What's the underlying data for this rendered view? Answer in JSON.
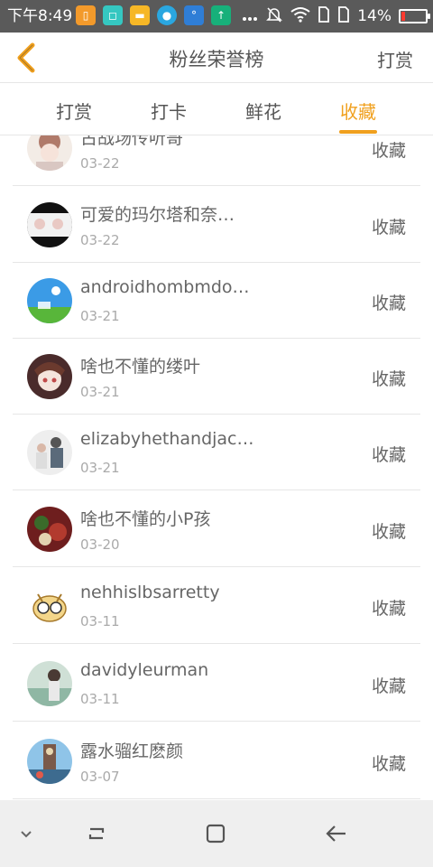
{
  "status_bar": {
    "time": "下午8:49",
    "battery_percent": "14%",
    "battery_level": 0.14,
    "app_icons": [
      {
        "name": "orange-app-icon",
        "color": "#f39a2b"
      },
      {
        "name": "scan-app-icon",
        "color": "#35c7c1"
      },
      {
        "name": "files-app-icon",
        "color": "#f6b726"
      },
      {
        "name": "palette-app-icon",
        "color": "#2aa7e0"
      },
      {
        "name": "weather-app-icon",
        "color": "#2f7ed6"
      },
      {
        "name": "upload-app-icon",
        "color": "#17b07a"
      }
    ],
    "right_icons": [
      "more-dots-icon",
      "mute-bell-icon",
      "wifi-icon",
      "sim-1-icon",
      "sim-2-icon"
    ]
  },
  "header": {
    "back_icon": "chevron-left-icon",
    "title": "粉丝荣誉榜",
    "action": "打赏"
  },
  "tabs": [
    {
      "label": "打赏",
      "active": false
    },
    {
      "label": "打卡",
      "active": false
    },
    {
      "label": "鲜花",
      "active": false
    },
    {
      "label": "收藏",
      "active": true
    }
  ],
  "accent_color": "#f0a01e",
  "list": [
    {
      "name": "古战场传听哥",
      "date": "03-22",
      "action": "收藏"
    },
    {
      "name": "可爱的玛尔塔和奈…",
      "date": "03-22",
      "action": "收藏"
    },
    {
      "name": "androidhombmdo…",
      "date": "03-21",
      "action": "收藏"
    },
    {
      "name": "啥也不懂的缕叶",
      "date": "03-21",
      "action": "收藏"
    },
    {
      "name": "elizabyhethandjac…",
      "date": "03-21",
      "action": "收藏"
    },
    {
      "name": "啥也不懂的小P孩",
      "date": "03-20",
      "action": "收藏"
    },
    {
      "name": "nehhislbsarretty",
      "date": "03-11",
      "action": "收藏"
    },
    {
      "name": "davidyleurman",
      "date": "03-11",
      "action": "收藏"
    },
    {
      "name": "露水骝红麽颜",
      "date": "03-07",
      "action": "收藏"
    }
  ],
  "nav_bar": {
    "icons": [
      "collapse-icon",
      "recent-apps-icon",
      "home-icon",
      "back-arrow-icon"
    ]
  }
}
